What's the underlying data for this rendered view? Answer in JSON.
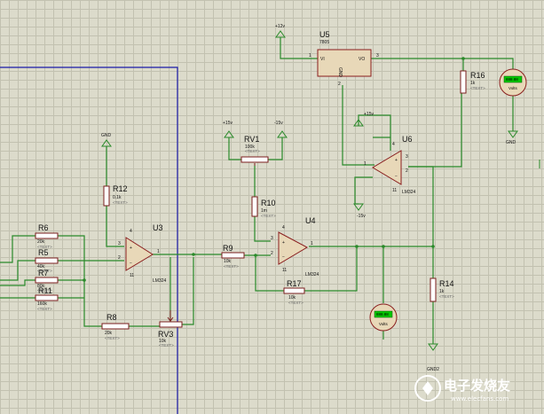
{
  "parts": {
    "u5": {
      "ref": "U5",
      "val": "7805"
    },
    "u3": {
      "ref": "U3",
      "val": "LM324"
    },
    "u4": {
      "ref": "U4",
      "val": "LM324"
    },
    "u6": {
      "ref": "U6",
      "val": "LM324"
    },
    "r6": {
      "ref": "R6",
      "val": "20k",
      "tx": "<TEXT>"
    },
    "r5": {
      "ref": "R5",
      "val": "40k",
      "tx": "<TEXT>"
    },
    "r7": {
      "ref": "R7",
      "val": "80k",
      "tx": "<TEXT>"
    },
    "r11": {
      "ref": "R11",
      "val": "160k",
      "tx": "<TEXT>"
    },
    "r12": {
      "ref": "R12",
      "val": "0.1k",
      "tx": "<TEXT>"
    },
    "r8": {
      "ref": "R8",
      "val": "20k",
      "tx": "<TEXT>"
    },
    "rv3": {
      "ref": "RV3",
      "val": "10k",
      "tx": "<TEXT>"
    },
    "r9": {
      "ref": "R9",
      "val": "10k",
      "tx": "<TEXT>"
    },
    "r10": {
      "ref": "R10",
      "val": "1m",
      "tx": "<TEXT>"
    },
    "rv1": {
      "ref": "RV1",
      "val": "100k",
      "tx": "<TEXT>"
    },
    "r17": {
      "ref": "R17",
      "val": "10k",
      "tx": "<TEXT>"
    },
    "r14": {
      "ref": "R14",
      "val": "1k",
      "tx": "<TEXT>"
    },
    "r16": {
      "ref": "R16",
      "val": "1k",
      "tx": "<TEXT>"
    }
  },
  "rails": {
    "p12": "+12v",
    "p15": "+15v",
    "n15": "-15v",
    "p15b": "+15v",
    "n15b": "-15v",
    "gnd": "GND",
    "gnd2": "GND",
    "gnd3": "GND2"
  },
  "pins": {
    "vi": "VI",
    "vo": "VO",
    "gndpin": "GND"
  },
  "meters": {
    "unit": "Volts",
    "reading": "888.88"
  },
  "watermark": {
    "brand": "电子发烧友",
    "site": "www.elecfans.com"
  },
  "colors": {
    "wire": "#2a8a2a",
    "component": "#8a1e1e",
    "grid": "#c2c1b0",
    "border": "#1a1aa8",
    "meter_lcd": "#00c800"
  }
}
